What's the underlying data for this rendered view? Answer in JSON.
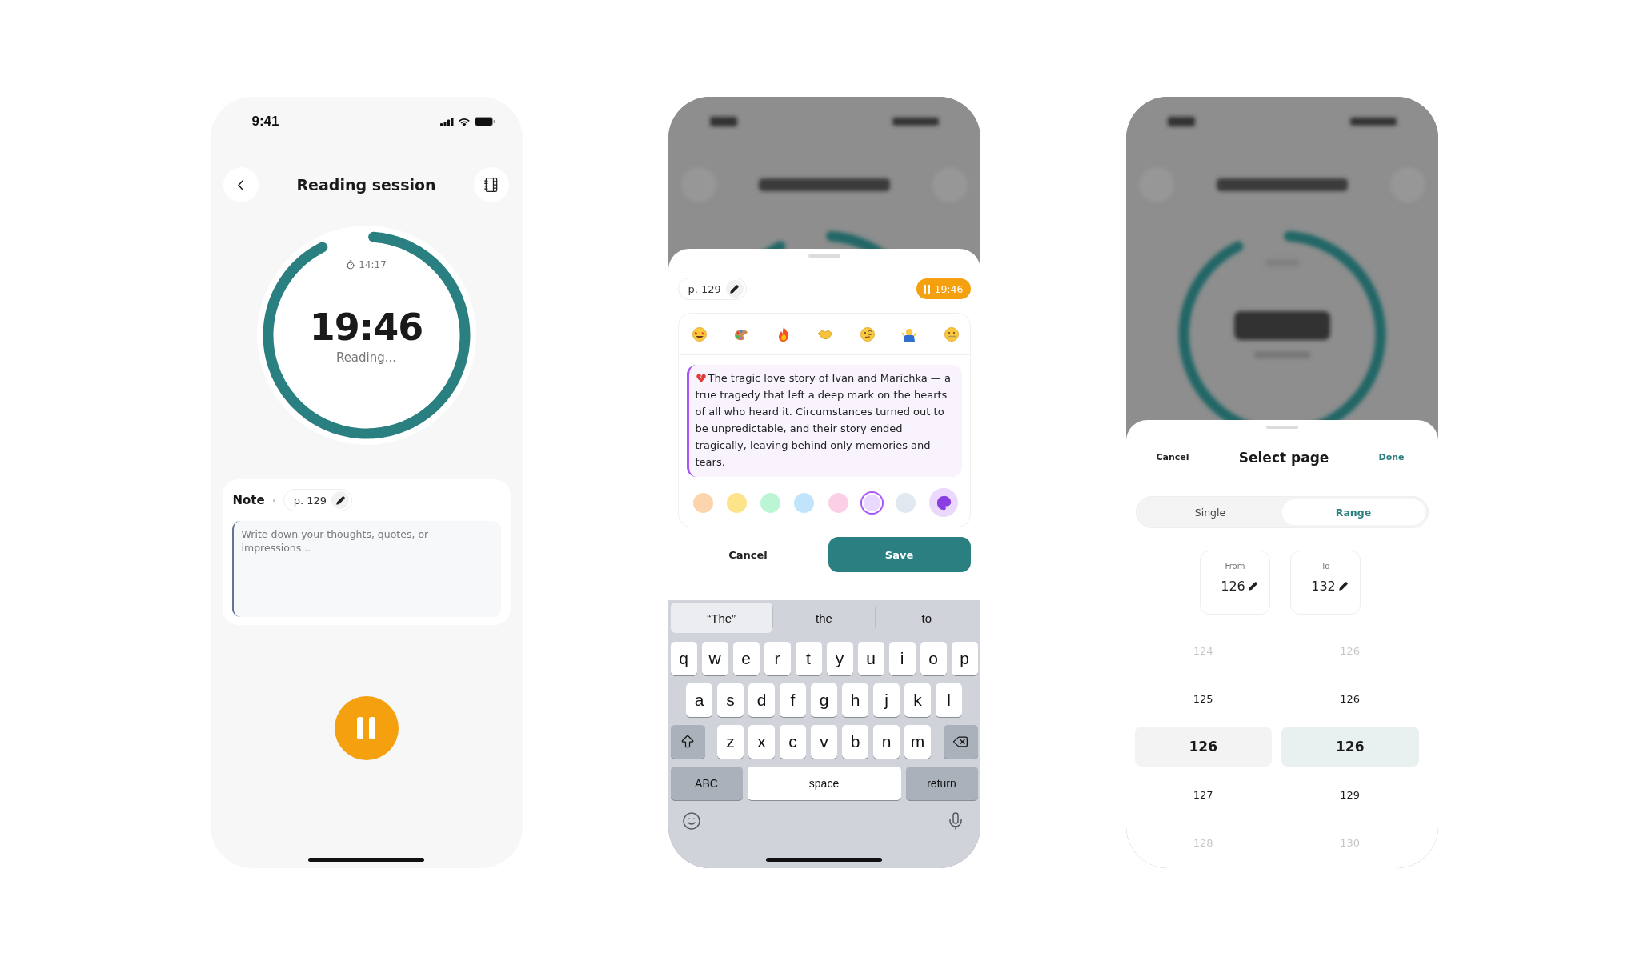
{
  "reading_screen": {
    "status_bar": {
      "time": "9:41"
    },
    "header": {
      "title": "Reading session"
    },
    "timer": {
      "elapsed": "14:17",
      "value": "19:46",
      "status": "Reading...",
      "level": 0.93
    },
    "note": {
      "title": "Note",
      "page": "p. 129",
      "placeholder": "Write down your thoughts, quotes, or impressions..."
    }
  },
  "note_editor": {
    "page": "p. 129",
    "timer": "19:46",
    "quote": "The tragic love story of Ivan and Marichka — a true tragedy that left a deep mark on the hearts of all who heard it. Circumstances turned out to be unpredictable, and their story ended tragically, leaving behind only memories and tears.",
    "swatches": [
      {
        "color": "#fdd5ad",
        "selected": false
      },
      {
        "color": "#fde38a",
        "selected": false
      },
      {
        "color": "#bbf5d3",
        "selected": false
      },
      {
        "color": "#bfe4fb",
        "selected": false
      },
      {
        "color": "#fbd0e6",
        "selected": false
      },
      {
        "color": "#ead8fe",
        "selected": true
      },
      {
        "color": "#e2e8f0",
        "selected": false
      }
    ],
    "cancel": "Cancel",
    "save": "Save",
    "keyboard": {
      "suggestions": [
        {
          "label": "“The”",
          "selected": true
        },
        {
          "label": "the",
          "selected": false
        },
        {
          "label": "to",
          "selected": false
        }
      ],
      "rows": [
        [
          "q",
          "w",
          "e",
          "r",
          "t",
          "y",
          "u",
          "i",
          "o",
          "p"
        ],
        [
          "a",
          "s",
          "d",
          "f",
          "g",
          "h",
          "j",
          "k",
          "l"
        ],
        [
          "z",
          "x",
          "c",
          "v",
          "b",
          "n",
          "m"
        ]
      ],
      "abc": "ABC",
      "space": "space",
      "return": "return"
    }
  },
  "page_picker": {
    "header": {
      "cancel": "Cancel",
      "title": "Select page",
      "done": "Done"
    },
    "modes": [
      {
        "label": "Single",
        "selected": false
      },
      {
        "label": "Range",
        "selected": true
      }
    ],
    "range": {
      "from_label": "From",
      "from": "126",
      "to_label": "To",
      "to": "132"
    },
    "columns": [
      {
        "items": [
          {
            "label": "124",
            "selected": false
          },
          {
            "label": "125",
            "selected": false
          },
          {
            "label": "126",
            "selected": true
          },
          {
            "label": "127",
            "selected": false
          },
          {
            "label": "128",
            "selected": false
          }
        ]
      },
      {
        "items": [
          {
            "label": "126",
            "selected": false
          },
          {
            "label": "126",
            "selected": false
          },
          {
            "label": "126",
            "selected": true
          },
          {
            "label": "129",
            "selected": false
          },
          {
            "label": "130",
            "selected": false
          }
        ]
      }
    ]
  }
}
